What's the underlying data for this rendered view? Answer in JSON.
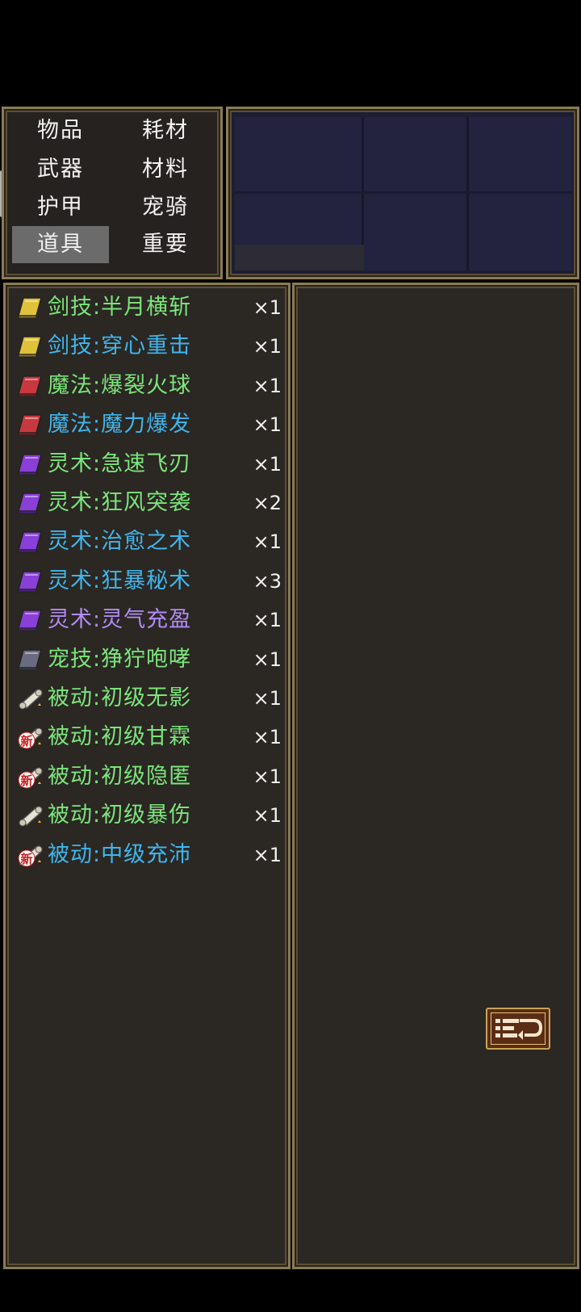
{
  "categories": [
    {
      "label": "物品",
      "selected": false
    },
    {
      "label": "耗材",
      "selected": false
    },
    {
      "label": "武器",
      "selected": false
    },
    {
      "label": "材料",
      "selected": false
    },
    {
      "label": "护甲",
      "selected": false
    },
    {
      "label": "宠骑",
      "selected": false
    },
    {
      "label": "道具",
      "selected": true
    },
    {
      "label": "重要",
      "selected": false
    }
  ],
  "items": [
    {
      "name": "剑技:半月横斩",
      "qty": "×1",
      "icon": "gold-book-icon",
      "color": "green"
    },
    {
      "name": "剑技:穿心重击",
      "qty": "×1",
      "icon": "gold-book-icon",
      "color": "blue"
    },
    {
      "name": "魔法:爆裂火球",
      "qty": "×1",
      "icon": "red-book-icon",
      "color": "green"
    },
    {
      "name": "魔法:魔力爆发",
      "qty": "×1",
      "icon": "red-book-icon",
      "color": "blue"
    },
    {
      "name": "灵术:急速飞刃",
      "qty": "×1",
      "icon": "purple-book-icon",
      "color": "green"
    },
    {
      "name": "灵术:狂风突袭",
      "qty": "×2",
      "icon": "purple-book-icon",
      "color": "green"
    },
    {
      "name": "灵术:治愈之术",
      "qty": "×1",
      "icon": "purple-book-icon",
      "color": "blue"
    },
    {
      "name": "灵术:狂暴秘术",
      "qty": "×3",
      "icon": "purple-book-icon",
      "color": "blue"
    },
    {
      "name": "灵术:灵气充盈",
      "qty": "×1",
      "icon": "purple-book-icon",
      "color": "purple"
    },
    {
      "name": "宠技:狰狞咆哮",
      "qty": "×1",
      "icon": "gray-book-icon",
      "color": "green"
    },
    {
      "name": "被动:初级无影",
      "qty": "×1",
      "icon": "scroll-icon",
      "color": "green"
    },
    {
      "name": "被动:初级甘霖",
      "qty": "×1",
      "icon": "new-scroll-icon",
      "color": "green"
    },
    {
      "name": "被动:初级隐匿",
      "qty": "×1",
      "icon": "new-scroll-icon",
      "color": "green"
    },
    {
      "name": "被动:初级暴伤",
      "qty": "×1",
      "icon": "scroll-icon",
      "color": "green"
    },
    {
      "name": "被动:中级充沛",
      "qty": "×1",
      "icon": "new-scroll-icon",
      "color": "blue"
    }
  ],
  "new_badge": "新",
  "colors": {
    "green": "#7be57b",
    "blue": "#3fb6ec",
    "purple": "#b18cf6",
    "frame": "#8a7a55"
  }
}
